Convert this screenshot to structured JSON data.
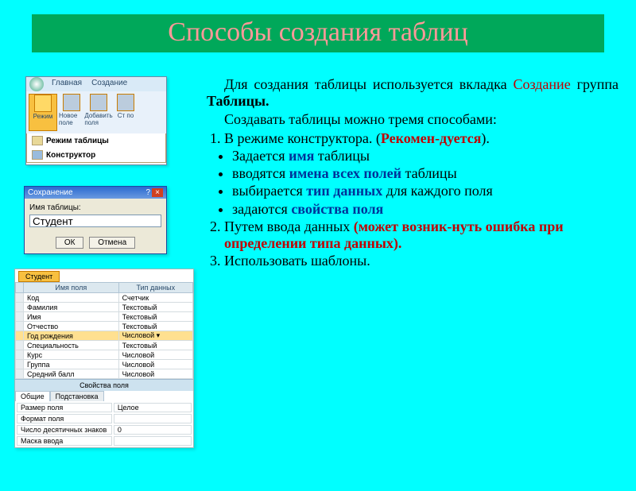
{
  "title": "Способы создания таблиц",
  "text": {
    "para1_a": "Для создания таблицы используется вкладка ",
    "para1_red": "Создание",
    "para1_b": " группа ",
    "para1_bold": "Таблицы.",
    "para2": "Создавать таблицы можно тремя способами:",
    "item1_a": "В режиме конструктора. (",
    "item1_red": "Рекомен-дуется",
    "item1_b": ").",
    "b1_a": "Задается ",
    "b1_blue": "имя",
    "b1_b": " таблицы",
    "b2_a": "вводятся ",
    "b2_blue": "имена всех полей",
    "b2_b": " таблицы",
    "b3_a": "выбирается ",
    "b3_blue": "тип данных",
    "b3_b": " для каждого поля",
    "b4_a": "задаются ",
    "b4_blue": "свойства поля",
    "item2_a": "Путем ввода данных ",
    "item2_red": "(может возник-нуть ошибка при определении типа данных).",
    "item3": "Использовать шаблоны."
  },
  "ribbon": {
    "tab1": "Главная",
    "tab2": "Создание",
    "b1": "Режим",
    "b2": "Новое поле",
    "b3": "Добавить поля",
    "b4": "Ст по",
    "mi1": "Режим таблицы",
    "mi2": "Конструктор"
  },
  "dialog": {
    "title": "Сохранение",
    "label": "Имя таблицы:",
    "value": "Студент",
    "ok": "ОК",
    "cancel": "Отмена"
  },
  "design": {
    "tab": "Студент",
    "col1": "Имя поля",
    "col2": "Тип данных",
    "rows": [
      {
        "n": "Код",
        "t": "Счетчик"
      },
      {
        "n": "Фамилия",
        "t": "Текстовый"
      },
      {
        "n": "Имя",
        "t": "Текстовый"
      },
      {
        "n": "Отчество",
        "t": "Текстовый"
      },
      {
        "n": "Год рождения",
        "t": "Числовой"
      },
      {
        "n": "Специальность",
        "t": "Текстовый"
      },
      {
        "n": "Курс",
        "t": "Числовой"
      },
      {
        "n": "Группа",
        "t": "Числовой"
      },
      {
        "n": "Средний балл",
        "t": "Числовой"
      }
    ],
    "props_hdr": "Свойства поля",
    "ptab1": "Общие",
    "ptab2": "Подстановка",
    "prop1": "Размер поля",
    "pval1": "Целое",
    "prop2": "Формат поля",
    "prop3": "Число десятичных знаков",
    "pval3": "0",
    "prop4": "Маска ввода"
  }
}
